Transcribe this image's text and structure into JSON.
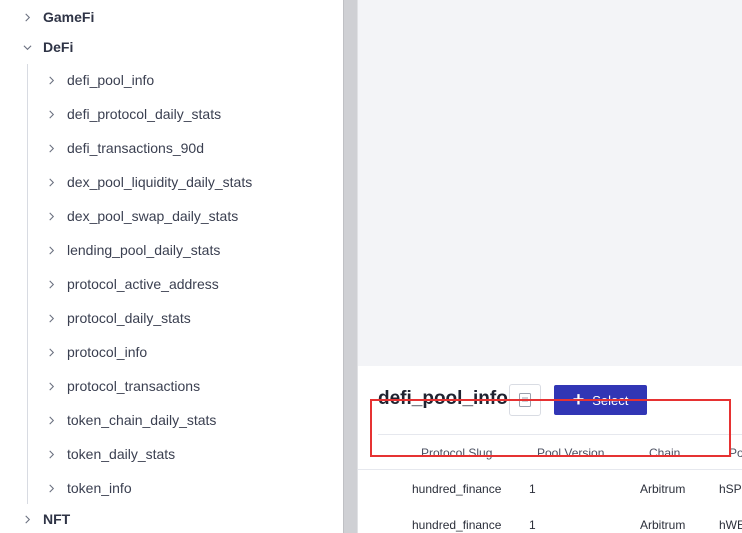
{
  "sidebar": {
    "categories": [
      {
        "label": "GameFi",
        "expanded": false
      },
      {
        "label": "DeFi",
        "expanded": true
      },
      {
        "label": "NFT",
        "expanded": false
      }
    ],
    "defi_children": [
      "defi_pool_info",
      "defi_protocol_daily_stats",
      "defi_transactions_90d",
      "dex_pool_liquidity_daily_stats",
      "dex_pool_swap_daily_stats",
      "lending_pool_daily_stats",
      "protocol_active_address",
      "protocol_daily_stats",
      "protocol_info",
      "protocol_transactions",
      "token_chain_daily_stats",
      "token_daily_stats",
      "token_info"
    ]
  },
  "main": {
    "table_title": "defi_pool_info",
    "copy_icon": "document-icon",
    "select_button": {
      "icon": "plus",
      "label": "Select"
    },
    "columns": [
      "Protocol Slug",
      "Pool Version",
      "Chain",
      "Po"
    ],
    "rows": [
      [
        "hundred_finance",
        "1",
        "Arbitrum",
        "hSP"
      ],
      [
        "hundred_finance",
        "1",
        "Arbitrum",
        "hWE"
      ]
    ]
  },
  "colors": {
    "accent": "#3136b5",
    "highlight": "#e63232",
    "splitter": "#cfd0d4"
  }
}
